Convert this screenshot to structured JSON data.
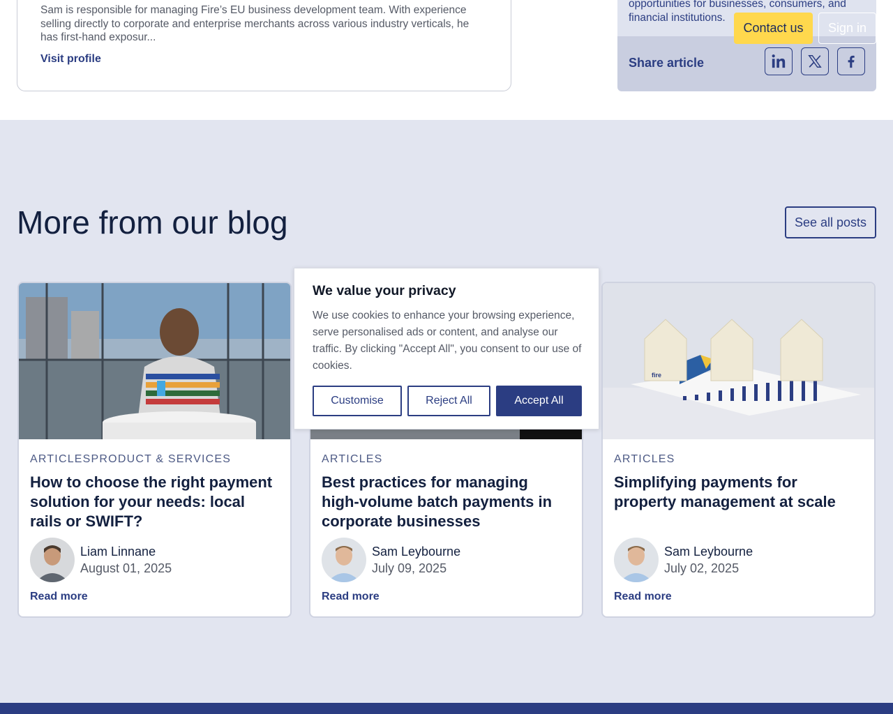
{
  "author": {
    "bio": "Sam is responsible for managing Fire’s EU business development team. With experience selling directly to corporate and enterprise merchants across various industry verticals, he has first-hand exposur...",
    "visit_profile": "Visit profile"
  },
  "sidebar": {
    "text": "opportunities for businesses, consumers, and financial institutions.",
    "share_label": "Share article",
    "share_icons": [
      "linkedin-icon",
      "x-icon",
      "facebook-icon"
    ]
  },
  "header": {
    "contact_label": "Contact us",
    "signin_label": "Sign in"
  },
  "blog": {
    "title": "More from our blog",
    "see_all": "See all posts",
    "cards": [
      {
        "category": "ARTICLESPRODUCT & SERVICES",
        "title": "How to choose the right payment solution for your needs: local rails or SWIFT?",
        "author": "Liam Linnane",
        "date": "August 01, 2025",
        "read_more": "Read more"
      },
      {
        "category": "ARTICLES",
        "title": "Best practices for managing high-volume batch payments in corporate businesses",
        "author": "Sam Leybourne",
        "date": "July 09, 2025",
        "read_more": "Read more"
      },
      {
        "category": "ARTICLES",
        "title": "Simplifying payments for property management at scale",
        "author": "Sam Leybourne",
        "date": "July 02, 2025",
        "read_more": "Read more"
      }
    ]
  },
  "cookie": {
    "title": "We value your privacy",
    "body": "We use cookies to enhance your browsing experience, serve personalised ads or content, and analyse our traffic. By clicking \"Accept All\", you consent to our use of cookies.",
    "customise": "Customise",
    "reject": "Reject All",
    "accept": "Accept All"
  },
  "colors": {
    "brand_navy": "#2b3d82",
    "accent_yellow": "#ffd84d",
    "section_bg": "#e2e5f0"
  }
}
